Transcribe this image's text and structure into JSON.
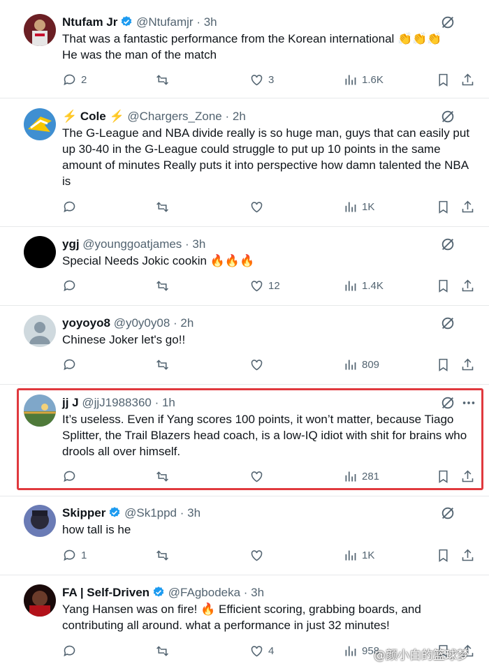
{
  "tweets": [
    {
      "name": "Ntufam Jr",
      "verified": true,
      "handle": "@Ntufamjr",
      "time": "· 3h",
      "text": "That was a fantastic performance from the Korean international 👏👏👏\nHe was the man of the match",
      "replies": "2",
      "reposts": "",
      "likes": "3",
      "views": "1.6K"
    },
    {
      "name": "⚡ Cole ⚡",
      "verified": false,
      "handle": "@Chargers_Zone",
      "time": "· 2h",
      "text": "The G-League and NBA divide really is so huge man, guys that can easily put up 30-40 in the G-League could struggle to put up 10 points in the same amount of minutes Really puts it into perspective how damn talented the NBA is",
      "replies": "",
      "reposts": "",
      "likes": "",
      "views": "1K"
    },
    {
      "name": "ygj",
      "verified": false,
      "handle": "@younggoatjames",
      "time": "· 3h",
      "text": "Special Needs Jokic cookin 🔥🔥🔥",
      "replies": "",
      "reposts": "",
      "likes": "12",
      "views": "1.4K"
    },
    {
      "name": "yoyoyo8",
      "verified": false,
      "handle": "@y0y0y08",
      "time": "· 2h",
      "text": "Chinese Joker let's go!!",
      "replies": "",
      "reposts": "",
      "likes": "",
      "views": "809"
    },
    {
      "name": "jj J",
      "verified": false,
      "handle": "@jjJ1988360",
      "time": "· 1h",
      "text": "It’s useless. Even if Yang scores 100 points, it won’t matter, because Tiago Splitter, the Trail Blazers head coach, is a low-IQ idiot with shit for brains who drools all over himself.",
      "replies": "",
      "reposts": "",
      "likes": "",
      "views": "281"
    },
    {
      "name": "Skipper",
      "verified": true,
      "handle": "@Sk1ppd",
      "time": "· 3h",
      "text": "how tall is he",
      "replies": "1",
      "reposts": "",
      "likes": "",
      "views": "1K"
    },
    {
      "name": "FA | Self-Driven",
      "verified": true,
      "handle": "@FAgbodeka",
      "time": "· 3h",
      "text": "Yang Hansen was on fire! 🔥 Efficient scoring, grabbing boards, and contributing all around. what a performance in just 32 minutes!",
      "replies": "",
      "reposts": "",
      "likes": "4",
      "views": "958"
    }
  ],
  "watermark": "@颜小白的篮球梦",
  "colors": {
    "accent": "#1d9bf0",
    "muted": "#536471",
    "highlight": "#e0393e"
  }
}
